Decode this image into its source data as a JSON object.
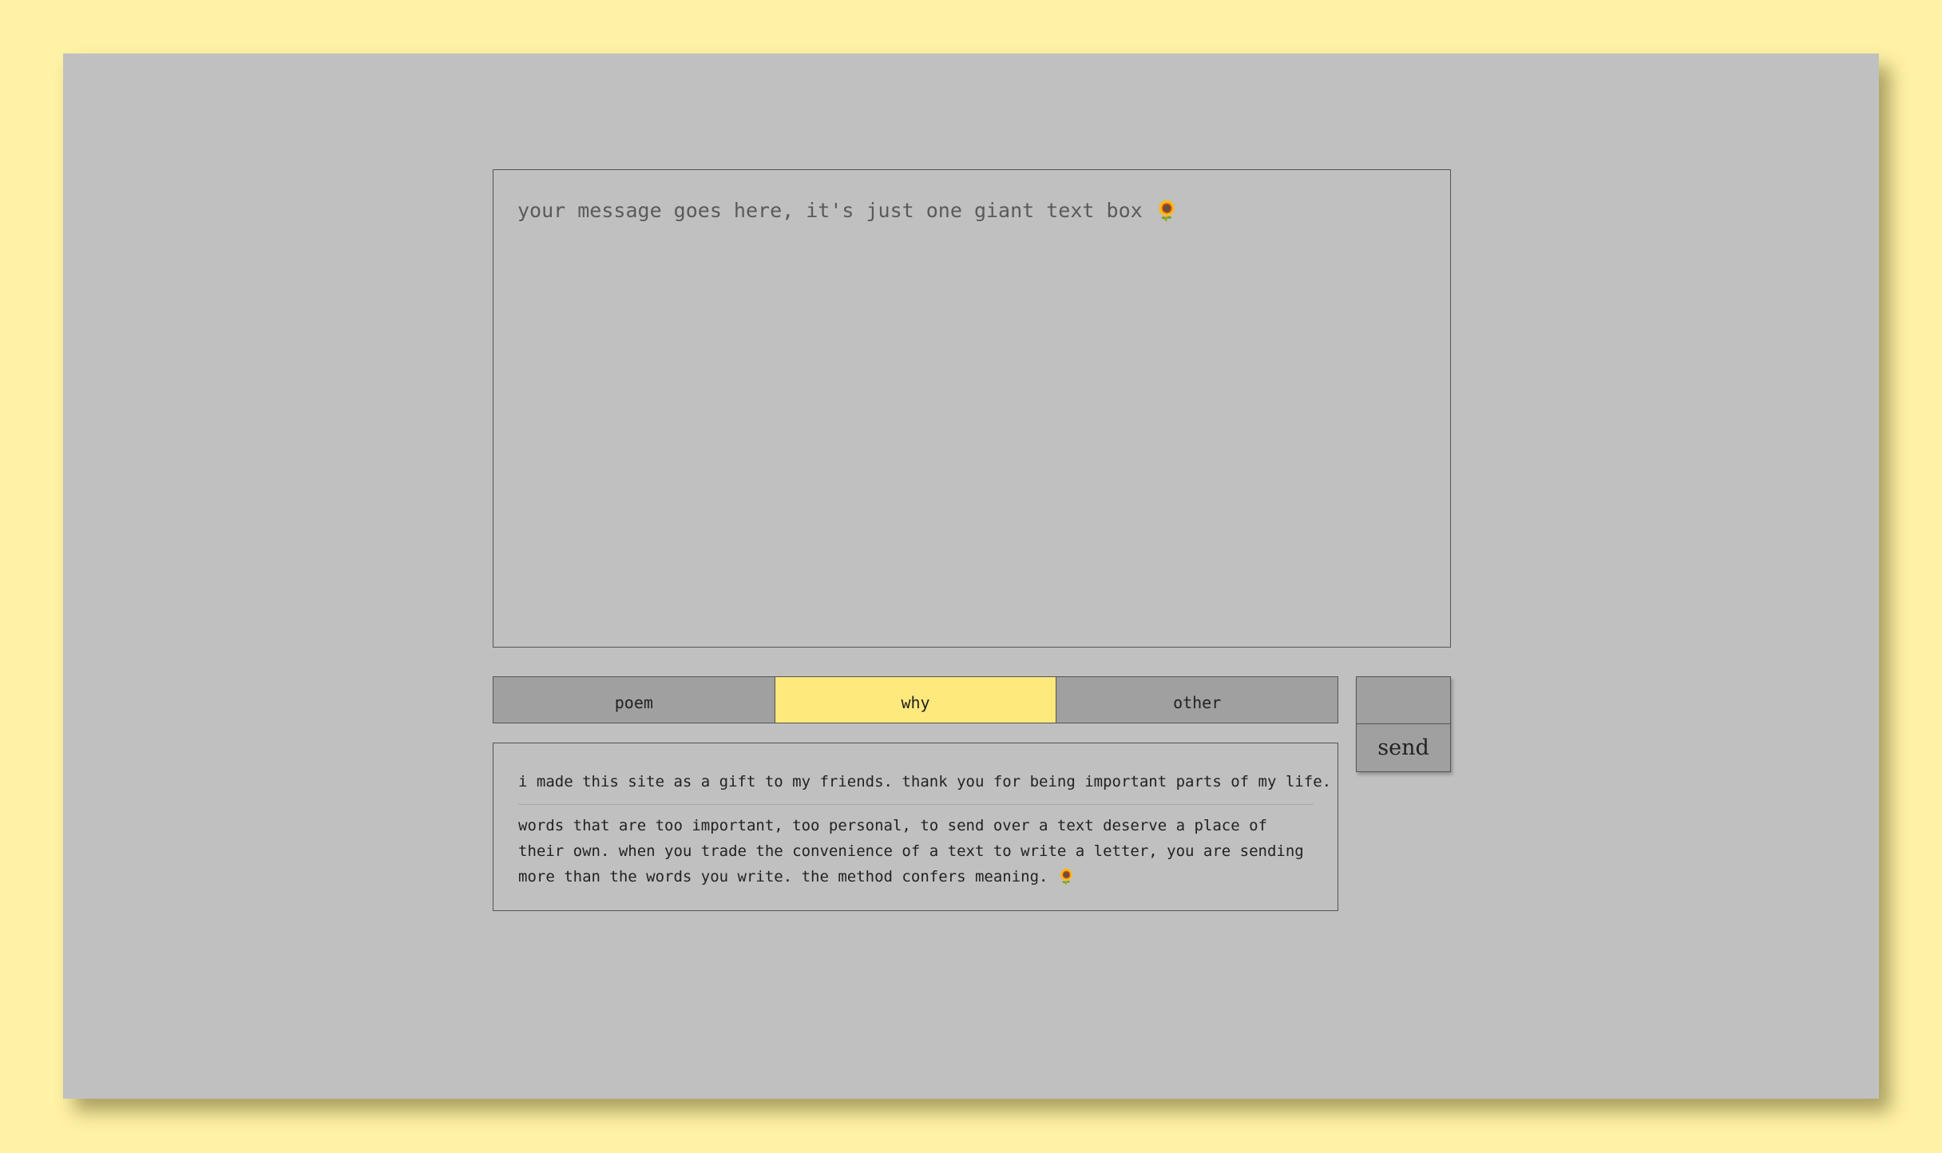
{
  "message": {
    "placeholder": "your message goes here, it's just one giant text box 🌻"
  },
  "tabs": [
    {
      "label": "poem",
      "active": false
    },
    {
      "label": "why",
      "active": true
    },
    {
      "label": "other",
      "active": false
    }
  ],
  "actions": {
    "send_label": "send"
  },
  "info": {
    "line1": "i made this site as a gift to my friends. thank you for being important parts of my life.",
    "paragraph": "words that are too important, too personal, to send over a text deserve a place of their own. when you trade the convenience of a text to write a letter, you are sending more than the words you write. the method confers meaning. 🌻"
  },
  "colors": {
    "page_background": "#fff2a4",
    "panel_background": "#c0c0c0",
    "tab_background": "#a0a0a0",
    "active_tab": "#fde97c",
    "border": "#545454"
  }
}
